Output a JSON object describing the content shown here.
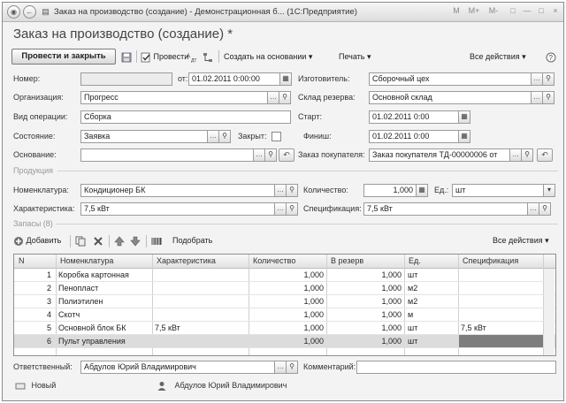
{
  "window": {
    "title": "Заказ на производство (создание) - Демонстрационная б... (1С:Предприятие)",
    "controls": [
      "M",
      "M+",
      "M-",
      "□",
      "—",
      "□",
      "×"
    ]
  },
  "form": {
    "title": "Заказ на производство (создание) *"
  },
  "toolbar": {
    "post_close": "Провести и закрыть",
    "post": "Провести",
    "create_based": "Создать на основании",
    "print": "Печать",
    "all_actions": "Все действия"
  },
  "fields": {
    "number_label": "Номер:",
    "number_value": "",
    "date_label": "от:",
    "date_value": "01.02.2011  0:00:00",
    "manufacturer_label": "Изготовитель:",
    "manufacturer_value": "Сборочный цех",
    "org_label": "Организация:",
    "org_value": "Прогресс",
    "reserve_wh_label": "Склад резерва:",
    "reserve_wh_value": "Основной склад",
    "op_type_label": "Вид операции:",
    "op_type_value": "Сборка",
    "start_label": "Старт:",
    "start_value": "01.02.2011  0:00",
    "state_label": "Состояние:",
    "state_value": "Заявка",
    "closed_label": "Закрыт:",
    "finish_label": "Финиш:",
    "finish_value": "01.02.2011  0:00",
    "basis_label": "Основание:",
    "basis_value": "",
    "customer_order_label": "Заказ покупателя:",
    "customer_order_value": "Заказ покупателя ТД-00000006 от",
    "product_group": "Продукция",
    "nomenclature_label": "Номенклатура:",
    "nomenclature_value": "Кондиционер БК",
    "quantity_label": "Количество:",
    "quantity_value": "1,000",
    "unit_label": "Ед.:",
    "unit_value": "шт",
    "characteristic_label": "Характеристика:",
    "characteristic_value": "7,5 кВт",
    "spec_label": "Спецификация:",
    "spec_value": "7,5 кВт",
    "stock_group": "Запасы (8)",
    "responsible_label": "Ответственный:",
    "responsible_value": "Абдулов Юрий Владимирович",
    "comment_label": "Комментарий:",
    "comment_value": ""
  },
  "table_toolbar": {
    "add": "Добавить",
    "pick": "Подобрать",
    "all_actions": "Все действия"
  },
  "table": {
    "headers": [
      "N",
      "Номенклатура",
      "Характеристика",
      "Количество",
      "В резерв",
      "Ед.",
      "Спецификация"
    ],
    "rows": [
      {
        "n": "1",
        "nom": "Коробка картонная",
        "char": "",
        "qty": "1,000",
        "res": "1,000",
        "unit": "шт",
        "spec": ""
      },
      {
        "n": "2",
        "nom": "Пенопласт",
        "char": "",
        "qty": "1,000",
        "res": "1,000",
        "unit": "м2",
        "spec": ""
      },
      {
        "n": "3",
        "nom": "Полиэтилен",
        "char": "",
        "qty": "1,000",
        "res": "1,000",
        "unit": "м2",
        "spec": ""
      },
      {
        "n": "4",
        "nom": "Скотч",
        "char": "",
        "qty": "1,000",
        "res": "1,000",
        "unit": "м",
        "spec": ""
      },
      {
        "n": "5",
        "nom": "Основной блок БК",
        "char": "7,5 кВт",
        "qty": "1,000",
        "res": "1,000",
        "unit": "шт",
        "spec": "7,5 кВт"
      },
      {
        "n": "6",
        "nom": "Пульт управления",
        "char": "",
        "qty": "1,000",
        "res": "1,000",
        "unit": "шт",
        "spec": ""
      }
    ]
  },
  "status": {
    "state": "Новый",
    "author": "Абдулов Юрий Владимирович"
  }
}
